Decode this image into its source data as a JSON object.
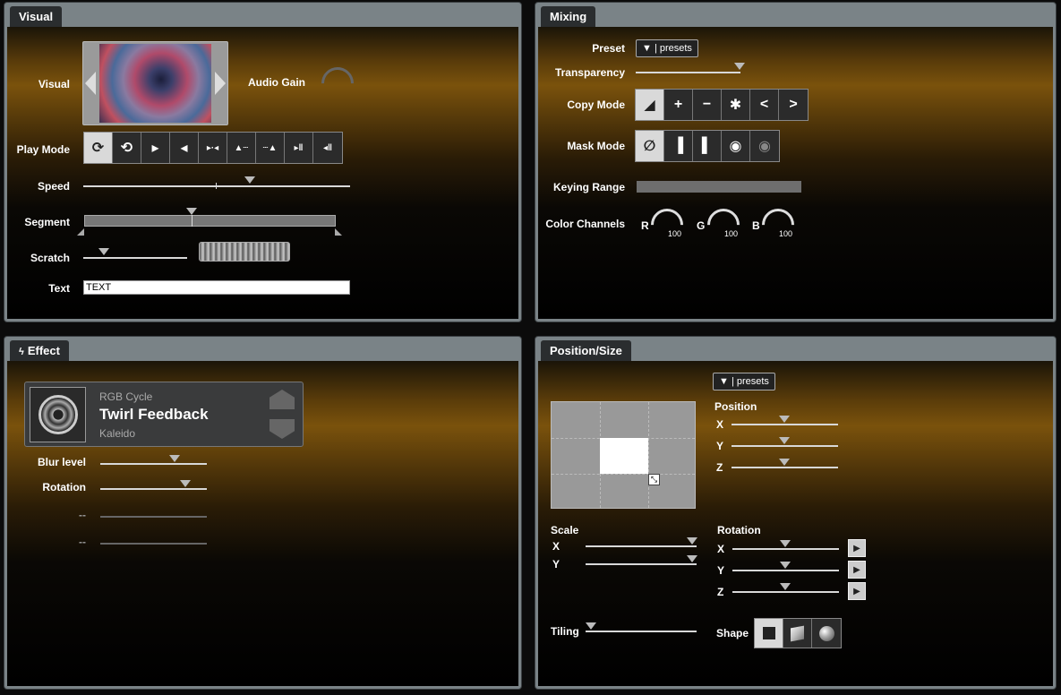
{
  "panels": {
    "visual": "Visual",
    "mixing": "Mixing",
    "effect": "Effect",
    "position": "Position/Size"
  },
  "visual": {
    "visual_label": "Visual",
    "audio_gain_label": "Audio Gain",
    "play_mode_label": "Play Mode",
    "speed_label": "Speed",
    "segment_label": "Segment",
    "scratch_label": "Scratch",
    "text_label": "Text",
    "text_value": "TEXT"
  },
  "mixing": {
    "preset_label": "Preset",
    "presets_button": "▼ | presets",
    "transparency_label": "Transparency",
    "copy_mode_label": "Copy Mode",
    "mask_mode_label": "Mask Mode",
    "keying_range_label": "Keying Range",
    "color_channels_label": "Color Channels",
    "channels": [
      {
        "name": "R",
        "value": "100"
      },
      {
        "name": "G",
        "value": "100"
      },
      {
        "name": "B",
        "value": "100"
      }
    ]
  },
  "effect": {
    "category": "RGB Cycle",
    "name": "Twirl Feedback",
    "subtitle": "Kaleido",
    "params": [
      {
        "label": "Blur level",
        "value": 0.7
      },
      {
        "label": "Rotation",
        "value": 0.8
      },
      {
        "label": "--",
        "value": null
      },
      {
        "label": "--",
        "value": null
      }
    ]
  },
  "position": {
    "presets_button": "▼ | presets",
    "position_label": "Position",
    "scale_label": "Scale",
    "rotation_label": "Rotation",
    "tiling_label": "Tiling",
    "shape_label": "Shape",
    "x": "X",
    "y": "Y",
    "z": "Z"
  },
  "icons": {
    "effect_tab": "bolt-icon",
    "play": "play-icon"
  }
}
